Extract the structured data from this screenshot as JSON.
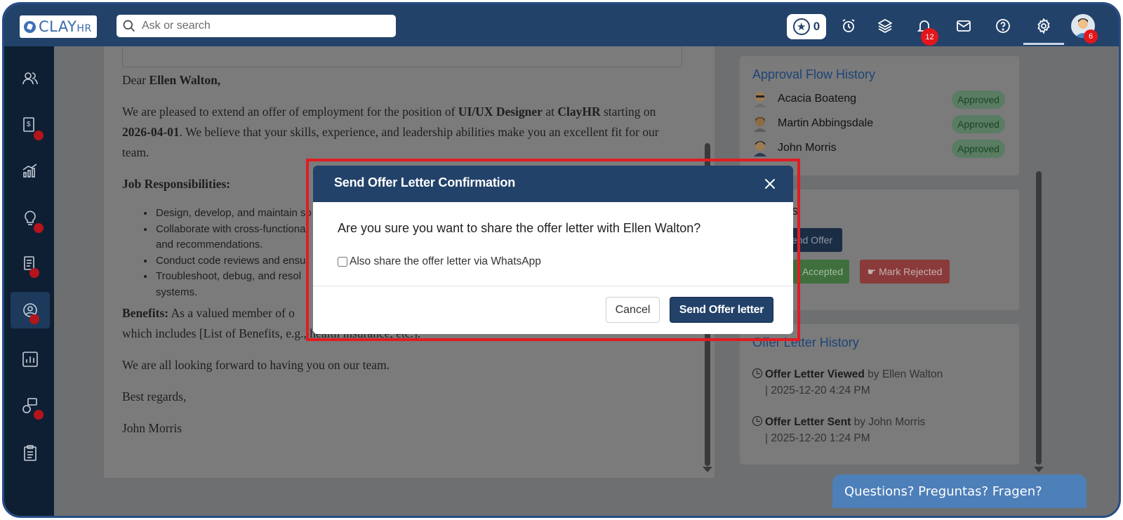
{
  "header": {
    "logo_text": "CLAY",
    "logo_suffix": "HR",
    "search_placeholder": "Ask or search",
    "points_count": "0",
    "notifications_count": "12",
    "avatar_badge_count": "6"
  },
  "letter": {
    "salutation_prefix": "Dear ",
    "candidate_name": "Ellen Walton,",
    "intro_1": "We are pleased to extend an offer of employment for the position of ",
    "position": "UI/UX Designer",
    "intro_2": " at ",
    "company": "ClayHR",
    "intro_3": " starting on ",
    "start_date": "2026-04-01",
    "intro_4": ". We believe that your skills, experience, and leadership abilities make you an excellent fit for our team.",
    "responsibilities_heading": "Job Responsibilities:",
    "responsibilities": [
      "Design, develop, and maintain so",
      "Collaborate with cross-functiona",
      "and recommendations.",
      "Conduct code reviews and ensu",
      "Troubleshoot, debug, and resol",
      "systems."
    ],
    "benefits_label": "Benefits:",
    "benefits_text_1": " As a valued member of o",
    "benefits_text_2": "which includes [List of Benefits, e.g., health insurance, etc.].",
    "closing_1": "We are all looking forward to having you on our team.",
    "closing_2": "Best regards,",
    "signature": "John Morris"
  },
  "approval": {
    "title": "Approval Flow History",
    "approvers": [
      {
        "name": "Acacia Boateng",
        "status": "Approved"
      },
      {
        "name": "Martin Abbingsdale",
        "status": "Approved"
      },
      {
        "name": "John Morris",
        "status": "Approved"
      }
    ]
  },
  "actions_panel": {
    "title_fragment": "s",
    "send_offer_label": "end Offer",
    "accepted_label": "Accepted",
    "rejected_label": "Mark Rejected"
  },
  "history": {
    "title": "Offer Letter History",
    "items": [
      {
        "event": "Offer Letter Viewed",
        "by": " by Ellen Walton",
        "when": "| 2025-12-20  4:24 PM"
      },
      {
        "event": "Offer Letter Sent",
        "by": " by John Morris",
        "when": "| 2025-12-20  1:24 PM"
      }
    ]
  },
  "help_button": "Questions? Preguntas? Fragen?",
  "modal": {
    "title": "Send Offer Letter Confirmation",
    "question": "Are you sure you want to share the offer letter with Ellen Walton?",
    "whatsapp_label": "Also share the offer letter via WhatsApp",
    "cancel_label": "Cancel",
    "send_label": "Send Offer letter"
  },
  "colors": {
    "topbar": "#22426a",
    "sidebar": "#0f1f33",
    "highlight": "#e21c22",
    "badge_red": "#e4161b",
    "primary_button": "#22426a"
  }
}
